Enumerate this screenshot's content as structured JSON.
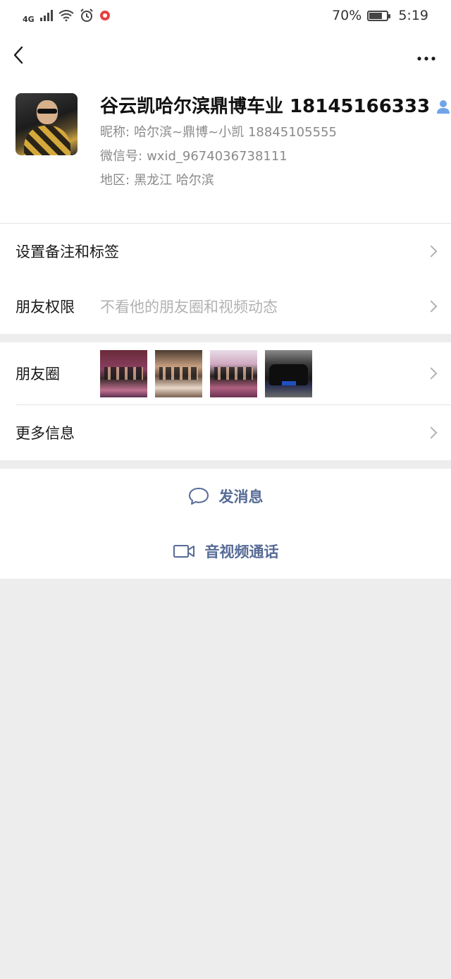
{
  "status_bar": {
    "network": "4G",
    "battery": "70%",
    "time": "5:19"
  },
  "profile": {
    "name": "谷云凯哈尔滨鼎博车业 18145166333",
    "nickname_label": "昵称:",
    "nickname": "哈尔滨~鼎博~小凯 18845105555",
    "wechat_id_label": "微信号:",
    "wechat_id": "wxid_9674036738111",
    "region_label": "地区:",
    "region": "黑龙江  哈尔滨"
  },
  "settings": {
    "remark_label": "设置备注和标签",
    "permission_label": "朋友权限",
    "permission_value": "不看他的朋友圈和视频动态"
  },
  "info": {
    "moments_label": "朋友圈",
    "more_label": "更多信息"
  },
  "actions": {
    "message_label": "发消息",
    "call_label": "音视频通话"
  },
  "colors": {
    "link": "#576b95",
    "background": "#ededed",
    "muted": "#8a8a8a",
    "contact_icon": "#6fa4e8"
  }
}
